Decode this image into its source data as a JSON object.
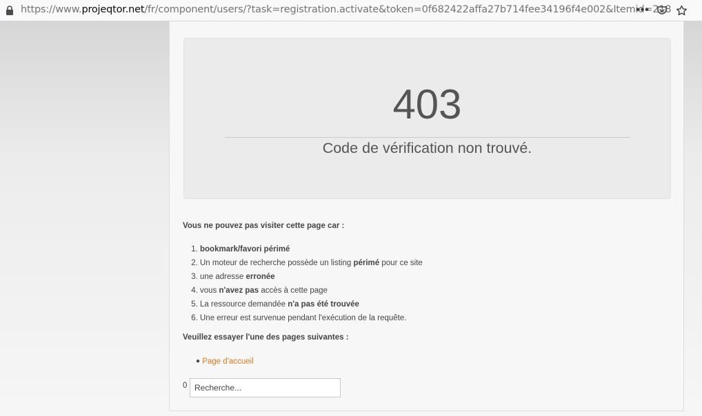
{
  "browser": {
    "url_domain_prefix": "https://www.",
    "url_domain": "projeqtor.net",
    "url_path": "/fr/component/users/?task=registration.activate&token=0f682422affa27b714fee34196f4e002&Itemid=218",
    "icons": {
      "lock": "lock-icon",
      "more": "more-icon",
      "pocket": "pocket-icon",
      "star": "star-icon"
    },
    "more_label": "•••"
  },
  "error": {
    "code": "403",
    "message": "Code de vérification non trouvé."
  },
  "reasons": {
    "heading": "Vous ne pouvez pas visiter cette page car :",
    "items": [
      {
        "num": "1.",
        "parts": [
          {
            "t": "bookmark/favori périmé",
            "b": true
          }
        ]
      },
      {
        "num": "2.",
        "parts": [
          {
            "t": "Un moteur de recherche possède un listing ",
            "b": false
          },
          {
            "t": "périmé",
            "b": true
          },
          {
            "t": " pour ce site",
            "b": false
          }
        ]
      },
      {
        "num": "3.",
        "parts": [
          {
            "t": "une adresse ",
            "b": false
          },
          {
            "t": "erronée",
            "b": true
          }
        ]
      },
      {
        "num": "4.",
        "parts": [
          {
            "t": "vous ",
            "b": false
          },
          {
            "t": "n'avez pas",
            "b": true
          },
          {
            "t": " accès à cette page",
            "b": false
          }
        ]
      },
      {
        "num": "5.",
        "parts": [
          {
            "t": "La ressource demandée ",
            "b": false
          },
          {
            "t": "n'a pas été trouvée",
            "b": true
          }
        ]
      },
      {
        "num": "6.",
        "parts": [
          {
            "t": "Une erreur est survenue pendant l'exécution de la requête.",
            "b": false
          }
        ]
      }
    ]
  },
  "suggestions": {
    "heading": "Veuillez essayer l'une des pages suivantes :",
    "bullet": "●",
    "home_link": "Page d'accueil"
  },
  "search": {
    "count": "0",
    "placeholder": "Recherche..."
  },
  "colors": {
    "link": "#e07a1f",
    "text": "#444444",
    "error_box_bg": "#ebebeb"
  }
}
